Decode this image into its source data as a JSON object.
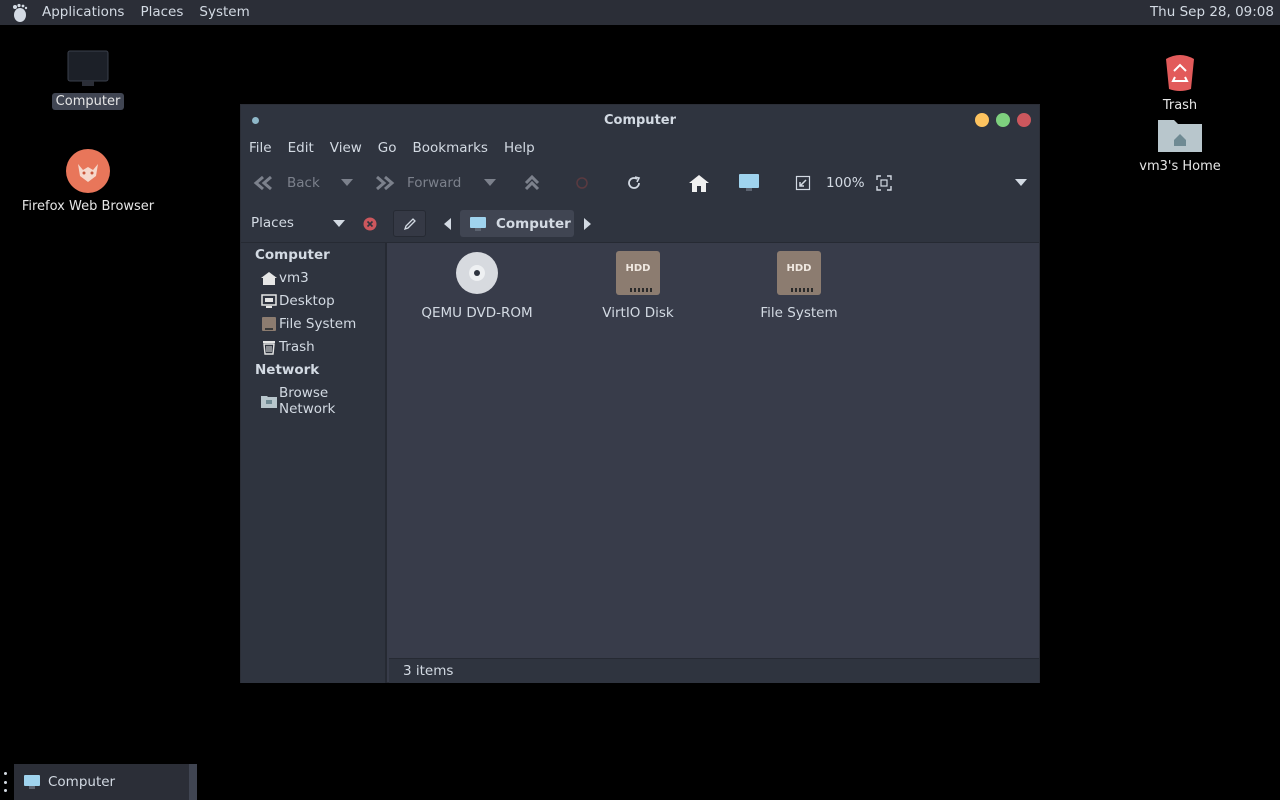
{
  "top_panel": {
    "menus": [
      "Applications",
      "Places",
      "System"
    ],
    "clock": "Thu Sep 28, 09:08"
  },
  "desktop": {
    "icons": {
      "computer": "Computer",
      "firefox": "Firefox Web Browser",
      "trash": "Trash",
      "home": "vm3's Home"
    }
  },
  "window": {
    "title": "Computer",
    "menu": [
      "File",
      "Edit",
      "View",
      "Go",
      "Bookmarks",
      "Help"
    ],
    "toolbar": {
      "back": "Back",
      "forward": "Forward",
      "zoom": "100%"
    },
    "location": {
      "places_label": "Places",
      "crumb": "Computer"
    },
    "sidebar": {
      "computer_heading": "Computer",
      "items": [
        "vm3",
        "Desktop",
        "File System",
        "Trash"
      ],
      "network_heading": "Network",
      "network_items": [
        "Browse Network"
      ]
    },
    "files": [
      {
        "name": "QEMU DVD-ROM",
        "icon": "optical-disc-icon"
      },
      {
        "name": "VirtIO Disk",
        "icon": "hdd-icon",
        "badge": "HDD"
      },
      {
        "name": "File System",
        "icon": "hdd-icon",
        "badge": "HDD"
      }
    ],
    "status": "3 items"
  },
  "taskbar": {
    "task_label": "Computer"
  },
  "colors": {
    "panel": "#2b2e37",
    "window_bg": "#383c4a",
    "chrome": "#2f343f",
    "close": "#cc575d",
    "minimize": "#fdc35f",
    "maximize": "#7ed07e",
    "firefox": "#e8765a",
    "trash": "#e25b5b"
  }
}
